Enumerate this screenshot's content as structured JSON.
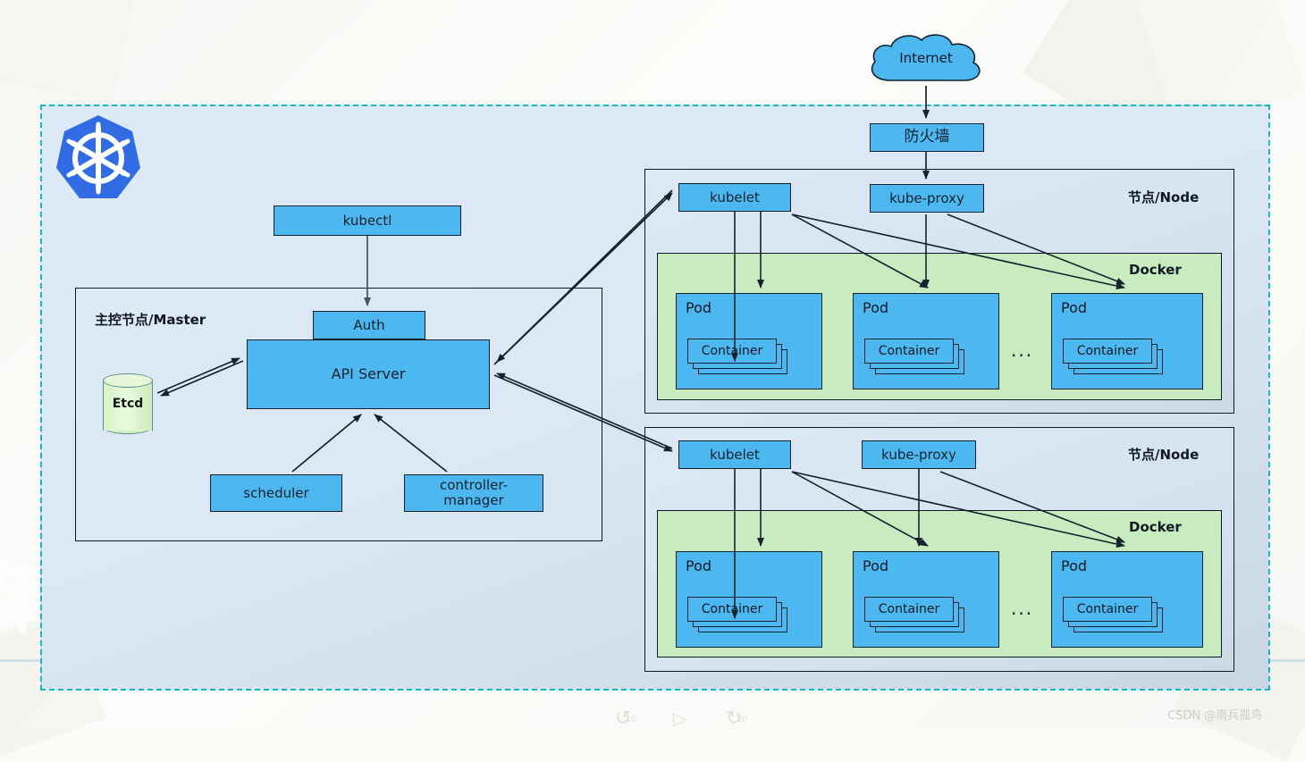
{
  "diagram": {
    "title_ghost": "架构",
    "cluster_border_color": "#18b6c4",
    "box_fill": "#4db8f0",
    "docker_fill": "#c8ecc0",
    "etcd_fill": "#d9f3c6",
    "k8s_blue": "#326ce5"
  },
  "internet": {
    "label": "Internet"
  },
  "firewall": {
    "label": "防火墙"
  },
  "master": {
    "panel_label": "主控节点/Master",
    "kubectl": "kubectl",
    "auth": "Auth",
    "api_server": "API Server",
    "etcd": "Etcd",
    "scheduler": "scheduler",
    "controller_manager": "controller-\nmanager",
    "controller_manager_line1": "controller-",
    "controller_manager_line2": "manager"
  },
  "nodes": [
    {
      "panel_label": "节点/Node",
      "kubelet": "kubelet",
      "kube_proxy": "kube-proxy",
      "docker_label": "Docker",
      "ellipsis": "...",
      "pods": [
        {
          "label": "Pod",
          "container": "Container"
        },
        {
          "label": "Pod",
          "container": "Container"
        },
        {
          "label": "Pod",
          "container": "Container"
        }
      ]
    },
    {
      "panel_label": "节点/Node",
      "kubelet": "kubelet",
      "kube_proxy": "kube-proxy",
      "docker_label": "Docker",
      "ellipsis": "...",
      "pods": [
        {
          "label": "Pod",
          "container": "Container"
        },
        {
          "label": "Pod",
          "container": "Container"
        },
        {
          "label": "Pod",
          "container": "Container"
        }
      ]
    }
  ],
  "player": {
    "rewind_label": "10",
    "forward_label": "30"
  },
  "watermark": {
    "text": "CSDN @南兵孤鸟"
  }
}
